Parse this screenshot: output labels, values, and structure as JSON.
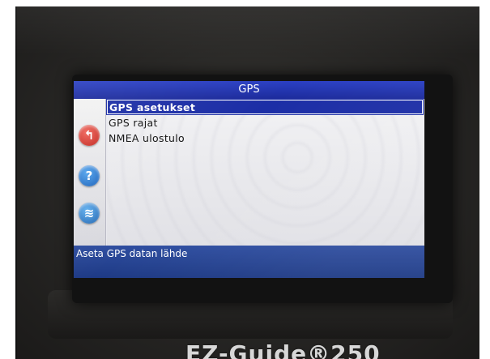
{
  "screen": {
    "title": "GPS",
    "menu": [
      {
        "label": "GPS asetukset",
        "selected": true
      },
      {
        "label": "GPS rajat",
        "selected": false
      },
      {
        "label": "NMEA ulostulo",
        "selected": false
      }
    ],
    "status": "Aseta GPS datan lähde",
    "side_buttons": {
      "back": {
        "icon": "back-arrow-icon",
        "glyph": "↰"
      },
      "help": {
        "icon": "help-icon",
        "glyph": "?"
      },
      "gps": {
        "icon": "gps-satellite-icon",
        "glyph": "≋"
      }
    }
  },
  "device": {
    "brand_text": "EZ-Guide®250"
  },
  "colors": {
    "title_bar": "#1c2b9c",
    "selection": "#1c2ea6",
    "status_bar": "#2f4ea0",
    "back_button": "#c0221a",
    "help_button": "#1a5fb8"
  }
}
